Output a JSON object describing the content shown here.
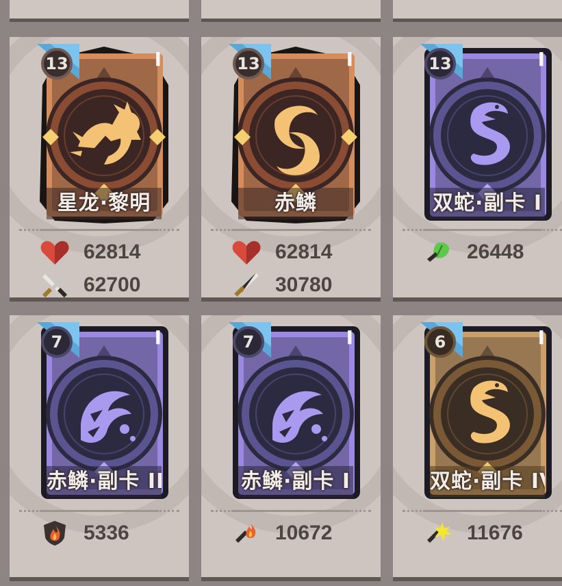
{
  "cards": [
    {
      "level": "13",
      "name": "星龙·黎明",
      "corner": "I",
      "theme": "orange",
      "emblem": "dragon-icon",
      "stats": [
        {
          "icon": "heart-icon",
          "value": "62814"
        },
        {
          "icon": "crossed-swords-icon",
          "value": "62700"
        }
      ]
    },
    {
      "level": "13",
      "name": "赤鳞",
      "corner": "I",
      "theme": "orange",
      "emblem": "twin-fish-icon",
      "stats": [
        {
          "icon": "heart-icon",
          "value": "62814"
        },
        {
          "icon": "sword-icon",
          "value": "30780"
        }
      ]
    },
    {
      "level": "13",
      "name": "双蛇·副卡 I",
      "corner": "I",
      "theme": "purple",
      "emblem": "serpent-icon",
      "stats": [
        {
          "icon": "green-leaf-icon",
          "value": "26448"
        }
      ]
    },
    {
      "level": "7",
      "name": "赤鳞·副卡 II",
      "corner": "I",
      "theme": "purple",
      "emblem": "fish-icon",
      "stats": [
        {
          "icon": "flame-shield-icon",
          "value": "5336"
        }
      ]
    },
    {
      "level": "7",
      "name": "赤鳞·副卡 I",
      "corner": "I",
      "theme": "purple",
      "emblem": "fish-icon",
      "stats": [
        {
          "icon": "flame-sword-icon",
          "value": "10672"
        }
      ]
    },
    {
      "level": "6",
      "name": "双蛇·副卡 IV",
      "corner": "I",
      "theme": "gold",
      "emblem": "serpent-icon",
      "stats": [
        {
          "icon": "spark-sword-icon",
          "value": "11676"
        }
      ]
    }
  ],
  "colors": {
    "orange_frame": "#d58e5b",
    "orange_dark": "#3b2624",
    "purple_frame": "#9b88e0",
    "purple_dark": "#2c2a40",
    "gold_frame": "#caa06a",
    "gold_dark": "#3a2d24",
    "corner_flag": "#5aa7d8",
    "heart": "#d84a3c"
  }
}
